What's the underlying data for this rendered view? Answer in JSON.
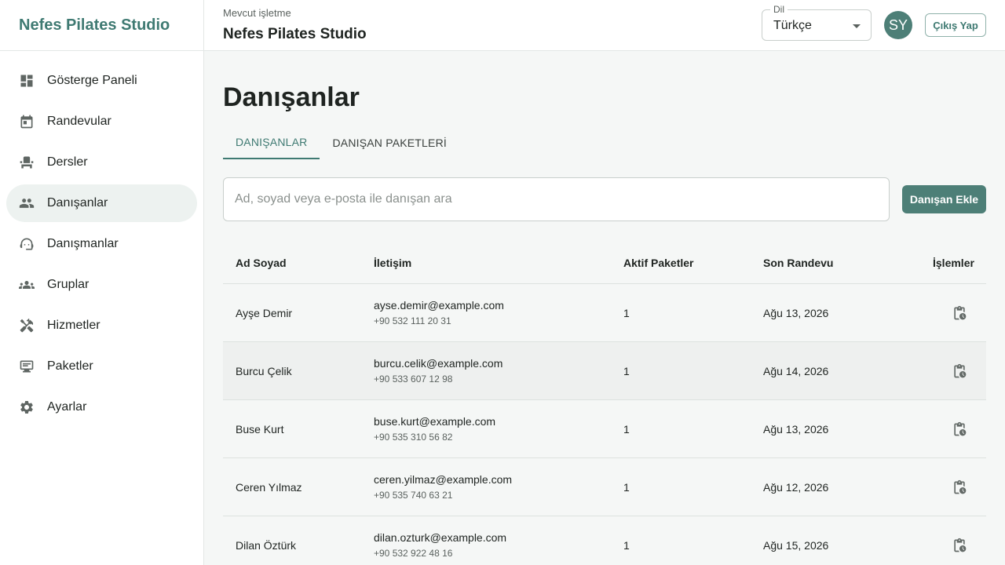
{
  "brand": "Nefes Pilates Studio",
  "nav": [
    {
      "label": "Gösterge Paneli",
      "icon": "dashboard-icon"
    },
    {
      "label": "Randevular",
      "icon": "calendar-icon"
    },
    {
      "label": "Dersler",
      "icon": "reformer-icon"
    },
    {
      "label": "Danışanlar",
      "icon": "people-icon"
    },
    {
      "label": "Danışmanlar",
      "icon": "support-agent-icon"
    },
    {
      "label": "Gruplar",
      "icon": "groups-icon"
    },
    {
      "label": "Hizmetler",
      "icon": "tools-icon"
    },
    {
      "label": "Paketler",
      "icon": "package-icon"
    },
    {
      "label": "Ayarlar",
      "icon": "gear-icon"
    }
  ],
  "topbar": {
    "caption": "Mevcut işletme",
    "business": "Nefes Pilates Studio",
    "lang_caption": "Dil",
    "lang_value": "Türkçe",
    "avatar": "SY",
    "logout": "Çıkış Yap"
  },
  "page": {
    "title": "Danışanlar",
    "tabs": [
      "DANIŞANLAR",
      "DANIŞAN PAKETLERİ"
    ],
    "search_placeholder": "Ad, soyad veya e-posta ile danışan ara",
    "add_button": "Danışan Ekle"
  },
  "table": {
    "headers": [
      "Ad Soyad",
      "İletişim",
      "Aktif Paketler",
      "Son Randevu",
      "İşlemler"
    ],
    "rows": [
      {
        "name": "Ayşe Demir",
        "email": "ayse.demir@example.com",
        "phone": "+90 532 111 20 31",
        "packages": "1",
        "last": "Ağu 13, 2026"
      },
      {
        "name": "Burcu Çelik",
        "email": "burcu.celik@example.com",
        "phone": "+90 533 607 12 98",
        "packages": "1",
        "last": "Ağu 14, 2026"
      },
      {
        "name": "Buse Kurt",
        "email": "buse.kurt@example.com",
        "phone": "+90 535 310 56 82",
        "packages": "1",
        "last": "Ağu 13, 2026"
      },
      {
        "name": "Ceren Yılmaz",
        "email": "ceren.yilmaz@example.com",
        "phone": "+90 535 740 63 21",
        "packages": "1",
        "last": "Ağu 12, 2026"
      },
      {
        "name": "Dilan Öztürk",
        "email": "dilan.ozturk@example.com",
        "phone": "+90 532 922 48 16",
        "packages": "1",
        "last": "Ağu 15, 2026"
      }
    ]
  },
  "colors": {
    "accent": "#3f7a72",
    "avatar_bg": "#4d7f77",
    "active_nav_bg": "#edf2f0"
  }
}
